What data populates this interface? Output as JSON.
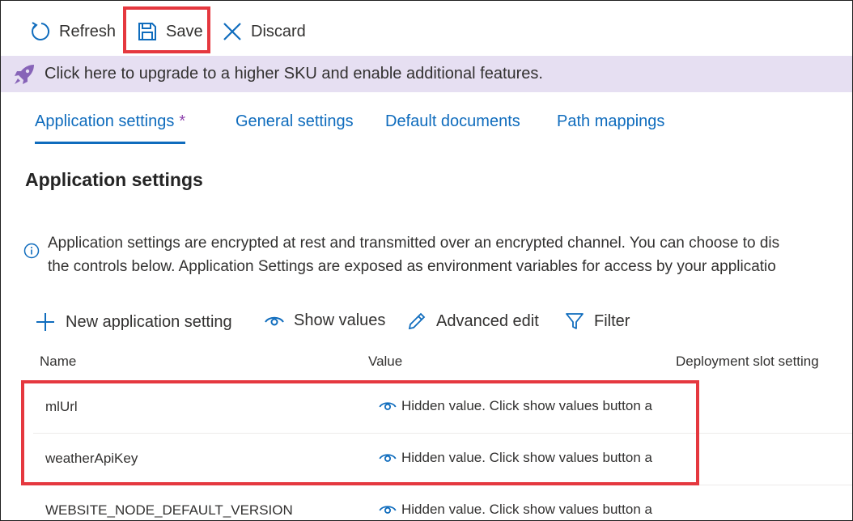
{
  "toolbar": {
    "refresh_label": "Refresh",
    "save_label": "Save",
    "discard_label": "Discard"
  },
  "banner": {
    "text": "Click here to upgrade to a higher SKU and enable additional features."
  },
  "tabs": [
    {
      "label": "Application settings",
      "marker": "*",
      "active": true
    },
    {
      "label": "General settings"
    },
    {
      "label": "Default documents"
    },
    {
      "label": "Path mappings"
    }
  ],
  "section": {
    "title": "Application settings",
    "info_line_1": "Application settings are encrypted at rest and transmitted over an encrypted channel. You can choose to dis",
    "info_line_2": "the controls below. Application Settings are exposed as environment variables for access by your applicatio"
  },
  "commands": {
    "new_label": "New application setting",
    "show_label": "Show values",
    "advanced_label": "Advanced edit",
    "filter_label": "Filter"
  },
  "table": {
    "headers": {
      "name": "Name",
      "value": "Value",
      "slot": "Deployment slot setting"
    },
    "rows": [
      {
        "name": "mlUrl",
        "value": "Hidden value. Click show values button a"
      },
      {
        "name": "weatherApiKey",
        "value": "Hidden value. Click show values button a"
      },
      {
        "name": "WEBSITE_NODE_DEFAULT_VERSION",
        "value": "Hidden value. Click show values button a"
      }
    ]
  },
  "colors": {
    "accent": "#0f6cbd",
    "highlight": "#e5383f",
    "banner_bg": "#e6dff2",
    "rocket": "#8764b8",
    "tab_marker": "#8e44ad"
  },
  "icons": {
    "refresh": "refresh-icon",
    "save": "save-icon",
    "discard": "close-icon",
    "banner": "rocket-icon",
    "info": "info-icon",
    "new": "plus-icon",
    "show": "eye-icon",
    "advanced": "pencil-icon",
    "filter": "filter-icon"
  }
}
